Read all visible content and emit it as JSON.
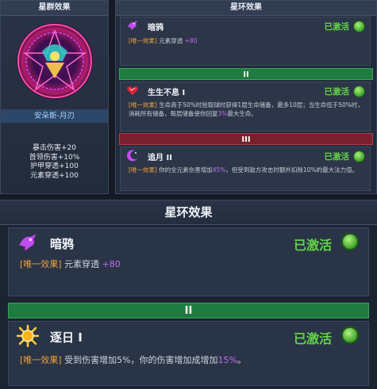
{
  "constellation": {
    "title": "星群效果",
    "hero_name": "安朵斯-月刃",
    "stats": [
      "暴击伤害+20",
      "首领伤害+10%",
      "护甲穿透+100",
      "元素穿透+100"
    ]
  },
  "ring": {
    "title": "星环效果",
    "active_label": "已激活",
    "tag_unique": "[唯一效果]",
    "tier2": "II",
    "tier3": "III",
    "skills": [
      {
        "name": "暗鸦",
        "icon": "crow-icon",
        "desc_text": "元素穿透",
        "desc_value": "+80"
      },
      {
        "name": "生生不息 I",
        "icon": "heart-regen-icon",
        "desc_a": "生命高于50%时拾取球时获得1层生命储备，最多10层；当生命低于50%时，消耗所有储备，每层储备使你回复",
        "desc_value": "3%",
        "desc_b": "最大生命。"
      },
      {
        "name": "追月 II",
        "icon": "moon-chase-icon",
        "desc_a": "你的全元素伤害增加",
        "desc_value": "45%",
        "desc_b": "，但受到敌方攻击时额外扣除10%的最大法力值。"
      }
    ]
  },
  "zoom": {
    "title": "星环效果",
    "active_label": "已激活",
    "tag_unique": "[唯一效果]",
    "tier2": "II",
    "skills": [
      {
        "name": "暗鸦",
        "icon": "crow-icon",
        "desc_text": "元素穿透",
        "desc_value": "+80"
      },
      {
        "name": "逐日 I",
        "icon": "sun-chase-icon",
        "desc_a": "受到伤害增加5%，你的伤害增加成增加",
        "desc_value": "15%",
        "desc_b": "。"
      }
    ]
  },
  "colors": {
    "active_green": "#63d247",
    "highlight_purple": "#c06cf4",
    "tag_orange": "#f0a23c",
    "tier_green": "#1f7b3f",
    "tier_red": "#7a1f2d"
  }
}
